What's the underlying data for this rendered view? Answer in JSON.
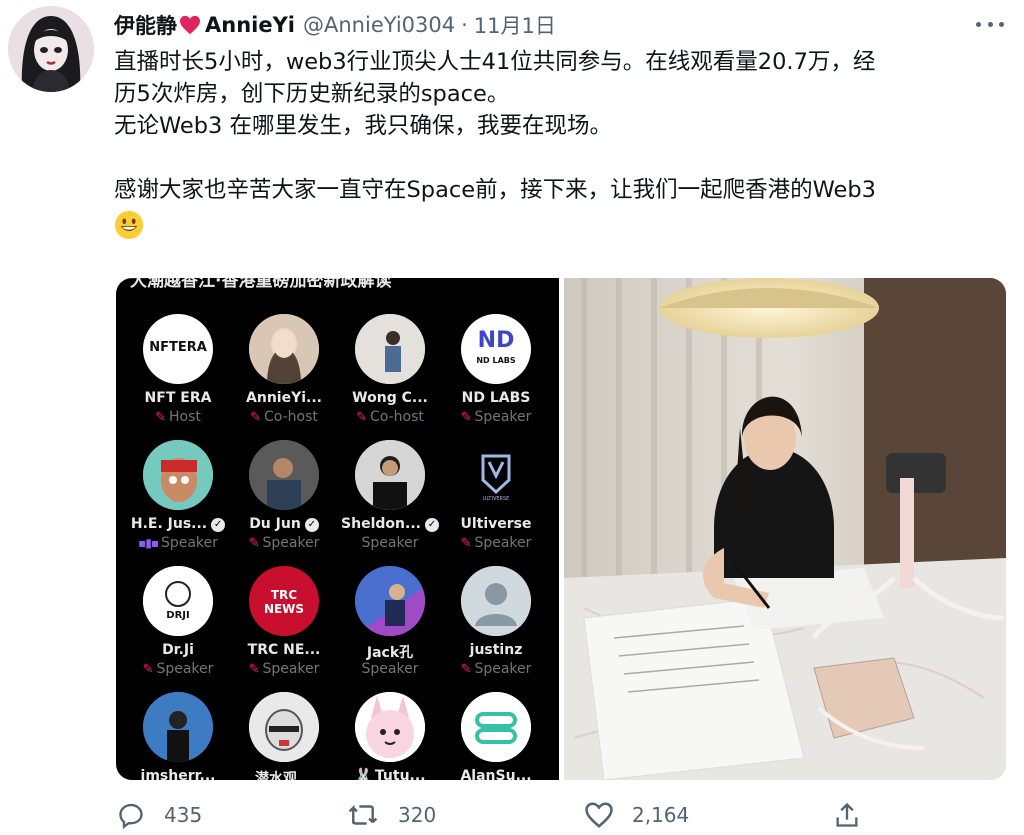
{
  "author": {
    "display_name": "伊能静",
    "name_suffix": "AnnieYi",
    "handle": "@AnnieYi0304",
    "separator": "·",
    "date": "11月1日"
  },
  "tweet": {
    "lines": [
      "直播时长5小时，web3行业顶尖人士41位共同参与。在线观看量20.7万，经",
      "历5次炸房，创下历史新纪录的space。",
      "无论Web3 在哪里发生，我只确保，我要在现场。",
      "",
      "感谢大家也辛苦大家一直守在Space前，接下来，让我们一起爬香港的Web3"
    ],
    "emoji": "grinning-face"
  },
  "space_panel": {
    "header_partial": "大潮越香江·香港重磅加密新政解读",
    "speakers": [
      {
        "name": "NFT ERA",
        "role": "Host",
        "badge": "mic",
        "avatar_text": "NFTERA"
      },
      {
        "name": "AnnieYi...",
        "role": "Co-host",
        "badge": "mic",
        "avatar_text": ""
      },
      {
        "name": "Wong C...",
        "role": "Co-host",
        "badge": "mic",
        "avatar_text": ""
      },
      {
        "name": "ND LABS",
        "role": "Speaker",
        "badge": "mic",
        "avatar_text": "ND LABS"
      },
      {
        "name": "H.E. Jus...",
        "role": "Speaker",
        "badge": "wave",
        "verified": true,
        "avatar_text": ""
      },
      {
        "name": "Du Jun",
        "role": "Speaker",
        "badge": "mic",
        "verified": true,
        "avatar_text": ""
      },
      {
        "name": "Sheldon...",
        "role": "Speaker",
        "badge": "none",
        "verified": true,
        "avatar_text": ""
      },
      {
        "name": "Ultiverse",
        "role": "Speaker",
        "badge": "mic",
        "avatar_text": "ULTIVERSE"
      },
      {
        "name": "Dr.Ji",
        "role": "Speaker",
        "badge": "mic",
        "avatar_text": "DRJI"
      },
      {
        "name": "TRC NE...",
        "role": "Speaker",
        "badge": "mic",
        "avatar_text": "TRC NEWS"
      },
      {
        "name": "Jack孔",
        "role": "Speaker",
        "badge": "none",
        "avatar_text": ""
      },
      {
        "name": "justinz",
        "role": "Speaker",
        "badge": "mic",
        "avatar_text": ""
      },
      {
        "name": "imsherr...",
        "role": "",
        "badge": "none",
        "avatar_text": ""
      },
      {
        "name": "潜水观...",
        "role": "",
        "badge": "none",
        "avatar_text": ""
      },
      {
        "name": "Tutu...",
        "role": "",
        "badge": "rabbit",
        "avatar_text": ""
      },
      {
        "name": "AlanSu...",
        "role": "",
        "badge": "none",
        "avatar_text": ""
      }
    ]
  },
  "actions": {
    "reply_count": "435",
    "retweet_count": "320",
    "like_count": "2,164"
  },
  "colors": {
    "text": "#0f1419",
    "muted": "#536471",
    "heart": "#e0245e",
    "space_mic": "#f91880",
    "space_bg": "#000000"
  }
}
